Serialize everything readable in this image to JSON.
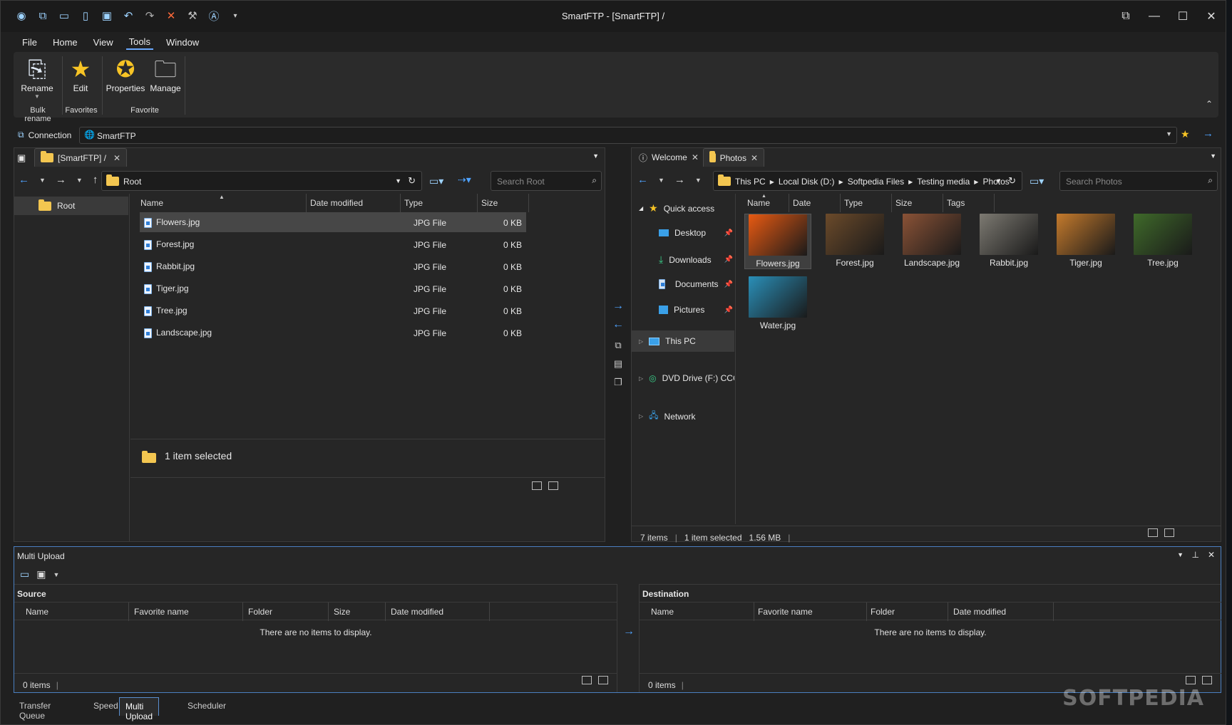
{
  "window": {
    "title": "SmartFTP - [SmartFTP] /",
    "minimize_icon": "—",
    "maximize_icon": "☐",
    "close_icon": "✕",
    "restore_icon": "⧉"
  },
  "menu": [
    "File",
    "Home",
    "View",
    "Tools",
    "Window"
  ],
  "ribbon": {
    "rename": "Rename",
    "edit": "Edit",
    "properties": "Properties",
    "manage": "Manage",
    "group_bulk": "Bulk rename",
    "group_favorites": "Favorites",
    "group_favorite": "Favorite"
  },
  "connection": {
    "label": "Connection",
    "value": "SmartFTP"
  },
  "left": {
    "tab": "[SmartFTP] /",
    "address": "Root",
    "search_placeholder": "Search Root",
    "tree_root": "Root",
    "columns": [
      "Name",
      "Date modified",
      "Type",
      "Size"
    ],
    "files": [
      {
        "name": "Flowers.jpg",
        "type": "JPG File",
        "size": "0 KB"
      },
      {
        "name": "Forest.jpg",
        "type": "JPG File",
        "size": "0 KB"
      },
      {
        "name": "Rabbit.jpg",
        "type": "JPG File",
        "size": "0 KB"
      },
      {
        "name": "Tiger.jpg",
        "type": "JPG File",
        "size": "0 KB"
      },
      {
        "name": "Tree.jpg",
        "type": "JPG File",
        "size": "0 KB"
      },
      {
        "name": "Landscape.jpg",
        "type": "JPG File",
        "size": "0 KB"
      }
    ],
    "selection": "1 item selected"
  },
  "right": {
    "tabs": [
      "Welcome",
      "Photos"
    ],
    "breadcrumb": [
      "This PC",
      "Local Disk (D:)",
      "Softpedia Files",
      "Testing media",
      "Photos"
    ],
    "search_placeholder": "Search Photos",
    "columns": [
      "Name",
      "Date",
      "Type",
      "Size",
      "Tags"
    ],
    "nav": {
      "quick_access": "Quick access",
      "desktop": "Desktop",
      "downloads": "Downloads",
      "documents": "Documents",
      "pictures": "Pictures",
      "this_pc": "This PC",
      "dvd": "DVD Drive (F:) CCCC",
      "network": "Network"
    },
    "thumbs": [
      {
        "name": "Flowers.jpg",
        "color": "#e85a12"
      },
      {
        "name": "Forest.jpg",
        "color": "#6b4a2a"
      },
      {
        "name": "Landscape.jpg",
        "color": "#8a5236"
      },
      {
        "name": "Rabbit.jpg",
        "color": "#7d7a72"
      },
      {
        "name": "Tiger.jpg",
        "color": "#c47a2c"
      },
      {
        "name": "Tree.jpg",
        "color": "#3f6a2a"
      },
      {
        "name": "Water.jpg",
        "color": "#2a8fb8"
      }
    ],
    "status_items": "7 items",
    "status_selected": "1 item selected",
    "status_size": "1.56 MB"
  },
  "multi": {
    "title": "Multi Upload",
    "source": "Source",
    "destination": "Destination",
    "source_columns": [
      "Name",
      "Favorite name",
      "Folder",
      "Size",
      "Date modified"
    ],
    "dest_columns": [
      "Name",
      "Favorite name",
      "Folder",
      "Date modified"
    ],
    "empty": "There are no items to display.",
    "count": "0 items"
  },
  "bottom_tabs": [
    "Transfer Queue",
    "Speed",
    "Multi Upload",
    "Scheduler"
  ],
  "watermark": "SOFTPEDIA",
  "colors": {
    "accent": "#4fa3ff",
    "background": "#202020"
  }
}
